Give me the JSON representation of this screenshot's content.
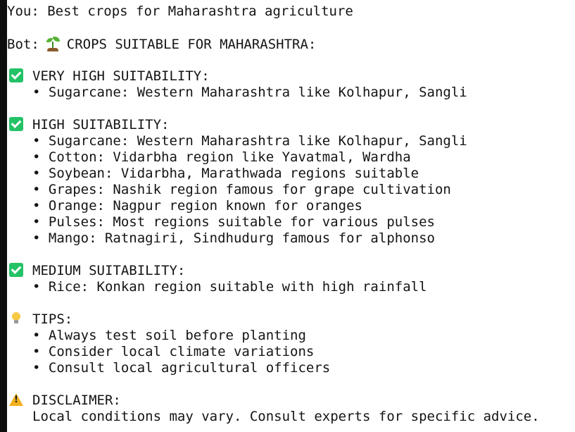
{
  "terminal": {
    "user_line": "You: Best crops for Maharashtra agriculture",
    "bot_prefix": "Bot:",
    "bot_heading": "CROPS SUITABLE FOR MAHARASHTRA:",
    "bot_heading_icon": "seedling-icon",
    "sections": {
      "very_high": {
        "icon": "check-mark-icon",
        "title": "VERY HIGH SUITABILITY:",
        "items": [
          "• Sugarcane: Western Maharashtra like Kolhapur, Sangli"
        ]
      },
      "high": {
        "icon": "check-mark-icon",
        "title": "HIGH SUITABILITY:",
        "items": [
          "• Sugarcane: Western Maharashtra like Kolhapur, Sangli",
          "• Cotton: Vidarbha region like Yavatmal, Wardha",
          "• Soybean: Vidarbha, Marathwada regions suitable",
          "• Grapes: Nashik region famous for grape cultivation",
          "• Orange: Nagpur region known for oranges",
          "• Pulses: Most regions suitable for various pulses",
          "• Mango: Ratnagiri, Sindhudurg famous for alphonso"
        ]
      },
      "medium": {
        "icon": "check-mark-icon",
        "title": "MEDIUM SUITABILITY:",
        "items": [
          "• Rice: Konkan region suitable with high rainfall"
        ]
      },
      "tips": {
        "icon": "light-bulb-icon",
        "title": "TIPS:",
        "items": [
          "• Always test soil before planting",
          "• Consider local climate variations",
          "• Consult local agricultural officers"
        ]
      },
      "disclaimer": {
        "icon": "warning-icon",
        "title": "DISCLAIMER:",
        "text": "Local conditions may vary. Consult experts for specific advice."
      }
    }
  },
  "colors": {
    "background": "#ffffff",
    "text": "#141414",
    "left_bar": "#0d0d0d",
    "check_green": "#23c267",
    "warning_yellow": "#f2b01e"
  }
}
